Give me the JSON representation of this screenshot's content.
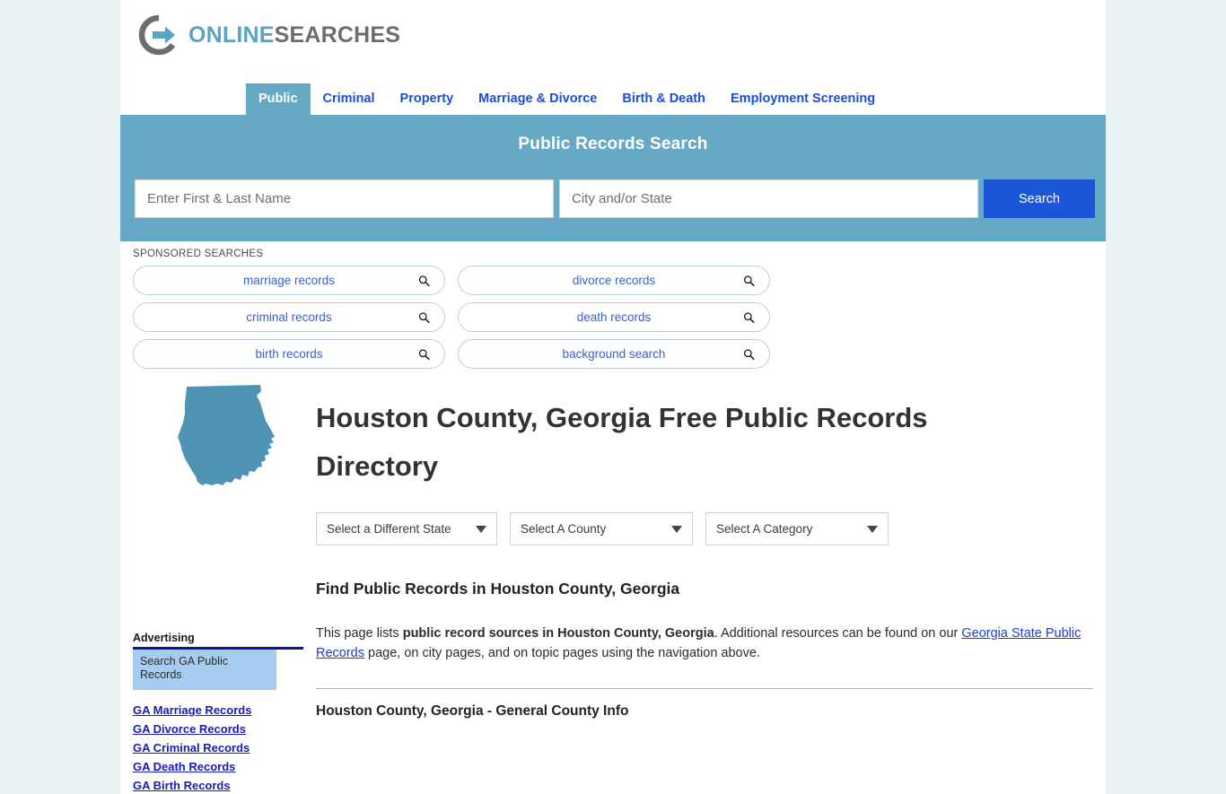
{
  "site": {
    "logo_primary": "ONLINE",
    "logo_secondary": "SEARCHES",
    "accent_teal": "#66a9c4",
    "accent_blue": "#1a56d6",
    "link_blue": "#1a4ed8",
    "page_bg": "#eaf1f4"
  },
  "nav": {
    "tabs": [
      {
        "label": "Public",
        "active": true
      },
      {
        "label": "Criminal",
        "active": false
      },
      {
        "label": "Property",
        "active": false
      },
      {
        "label": "Marriage & Divorce",
        "active": false
      },
      {
        "label": "Birth & Death",
        "active": false
      },
      {
        "label": "Employment Screening",
        "active": false
      }
    ]
  },
  "search": {
    "title": "Public Records Search",
    "name_placeholder": "Enter First & Last Name",
    "name_value": "",
    "city_placeholder": "City and/or State",
    "city_value": "",
    "button_label": "Search"
  },
  "sponsored": {
    "label": "SPONSORED SEARCHES",
    "items": [
      {
        "label": "marriage records"
      },
      {
        "label": "divorce records"
      },
      {
        "label": "criminal records"
      },
      {
        "label": "death records"
      },
      {
        "label": "birth records"
      },
      {
        "label": "background search"
      }
    ]
  },
  "main": {
    "state_map_alt": "Georgia state outline",
    "heading": "Houston County, Georgia Free Public Records Directory",
    "selects": [
      {
        "value": "Select a Different State"
      },
      {
        "value": "Select A County"
      },
      {
        "value": "Select A Category"
      }
    ],
    "section_heading": "Find Public Records in Houston County, Georgia",
    "paragraph": {
      "part1": "This page lists ",
      "bold1": "public record sources in Houston County, Georgia",
      "part2": ". Additional resources can be found on our ",
      "link1": "Georgia State Public Records",
      "part3": " page, on city pages, and on topic pages using the navigation above."
    },
    "next_section_heading": "Houston County, Georgia - General County Info"
  },
  "sidebar": {
    "ad_title": "Advertising",
    "ad_box_text": "Search GA Public Records",
    "links": [
      {
        "label": "GA Marriage Records"
      },
      {
        "label": "GA Divorce Records"
      },
      {
        "label": "GA Criminal Records"
      },
      {
        "label": "GA Death Records"
      },
      {
        "label": "GA Birth Records"
      }
    ]
  }
}
